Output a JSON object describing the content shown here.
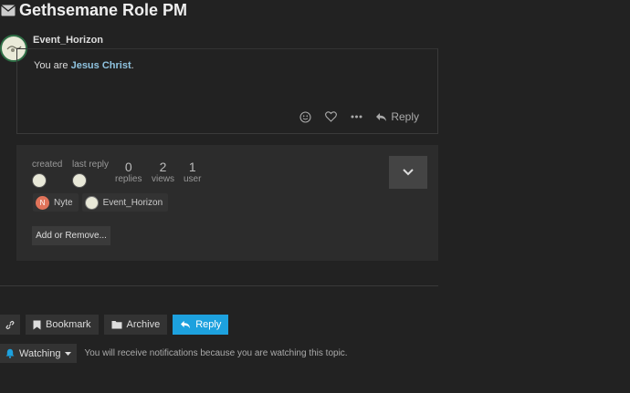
{
  "topic": {
    "title": "Gethsemane Role PM"
  },
  "post": {
    "username": "Event_Horizon",
    "text_prefix": "You are ",
    "mention": "Jesus Christ",
    "text_suffix": ".",
    "reply_label": "Reply"
  },
  "summary": {
    "created_label": "created",
    "last_reply_label": "last reply",
    "stats": [
      {
        "number": "0",
        "label": "replies"
      },
      {
        "number": "2",
        "label": "views"
      },
      {
        "number": "1",
        "label": "user"
      }
    ],
    "participants": [
      {
        "name": "Nyte",
        "initial": "N",
        "color": "#e0735a"
      },
      {
        "name": "Event_Horizon",
        "initial": "",
        "color": "#e8e8d8"
      }
    ],
    "add_remove_label": "Add or Remove..."
  },
  "controls": {
    "bookmark_label": "Bookmark",
    "archive_label": "Archive",
    "reply_label": "Reply"
  },
  "notifications": {
    "level_label": "Watching",
    "description": "You will receive notifications because you are watching this topic."
  },
  "colors": {
    "accent": "#1da1de",
    "mention": "#8fc3e0",
    "watch_bell": "#1da1de"
  }
}
